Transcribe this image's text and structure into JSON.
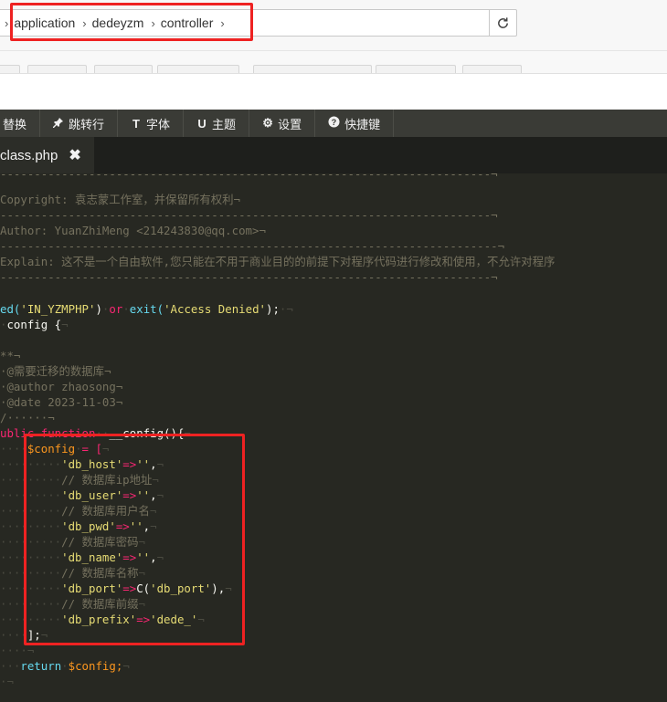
{
  "address_bar": {
    "crumbs": [
      "application",
      "dedeyzm",
      "controller"
    ]
  },
  "menu": {
    "items": [
      {
        "icon": "replace-icon",
        "label": "替换"
      },
      {
        "icon": "pin-icon",
        "label": "跳转行"
      },
      {
        "icon": "font-icon",
        "label": "字体"
      },
      {
        "icon": "theme-icon",
        "label": "主题"
      },
      {
        "icon": "gear-icon",
        "label": "设置"
      },
      {
        "icon": "help-icon",
        "label": "快捷键"
      }
    ]
  },
  "tab": {
    "filename": "class.php"
  },
  "code": {
    "comments": {
      "copyright": "Copyright: 袁志蒙工作室，并保留所有权利",
      "author": "Author: YuanZhiMeng <214243830@qq.com>",
      "explain": "Explain: 这不是一个自由软件,您只能在不用于商业目的的前提下对程序代码进行修改和使用，不允许对程序",
      "doc_title": "@需要迁移的数据库",
      "doc_author": "@author zhaosong",
      "doc_date": "@date 2023-11-03",
      "c_host": "// 数据库ip地址",
      "c_user": "// 数据库用户名",
      "c_pwd": "// 数据库密码",
      "c_name": "// 数据库名称",
      "c_prefix": "// 数据库前缀"
    },
    "define_call": "ed(",
    "define_const": "'IN_YZMPHP'",
    "define_or": "or",
    "define_exit": "exit(",
    "define_msg": "'Access Denied'",
    "define_end": ");",
    "class_line": "config {",
    "func_kw": "ublic function",
    "func_name": "__config(){",
    "config_var": "$config",
    "config_assign": "= [",
    "keys": {
      "host": "'db_host'",
      "user": "'db_user'",
      "pwd": "'db_pwd'",
      "name": "'db_name'",
      "port": "'db_port'",
      "prefix": "'db_prefix'"
    },
    "arrow": "=>",
    "empty_str": "''",
    "port_call": "C(",
    "port_arg": "'db_port'",
    "port_end": "),",
    "prefix_val": "'dede_'",
    "array_end": "];",
    "return_kw": "return",
    "return_var": "$config;"
  }
}
